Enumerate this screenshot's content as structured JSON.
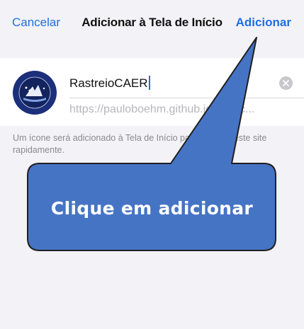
{
  "nav": {
    "cancel_label": "Cancelar",
    "title": "Adicionar à Tela de Início",
    "add_label": "Adicionar"
  },
  "bookmark": {
    "name_value": "RastreioCAER",
    "url": "https://pauloboehm.github.io/web-c...",
    "icon": "caer-logo-icon"
  },
  "footer": {
    "note": "Um ícone será adicionado à Tela de Início para acessar este site rapidamente."
  },
  "callout": {
    "text": "Clique em adicionar"
  },
  "colors": {
    "accent": "#1f6fe0",
    "callout_fill": "#4674c5",
    "background": "#f2f2f7"
  }
}
